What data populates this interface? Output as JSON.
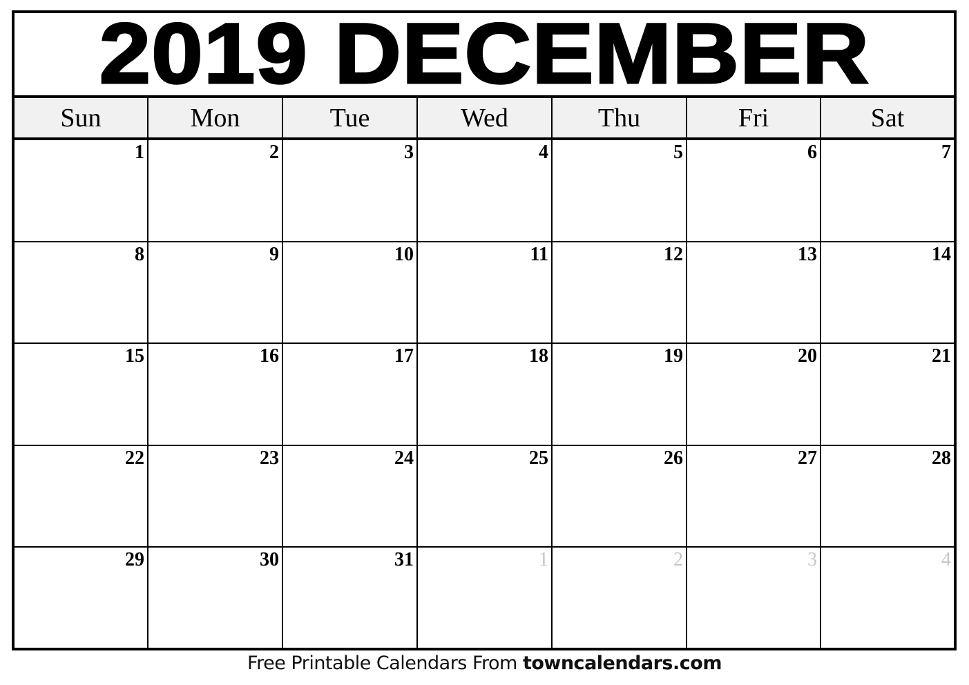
{
  "calendar": {
    "title": "2019 DECEMBER",
    "year": 2019,
    "month": "December",
    "weekdays": [
      "Sun",
      "Mon",
      "Tue",
      "Wed",
      "Thu",
      "Fri",
      "Sat"
    ],
    "weeks": [
      [
        {
          "day": "1"
        },
        {
          "day": "2"
        },
        {
          "day": "3"
        },
        {
          "day": "4"
        },
        {
          "day": "5"
        },
        {
          "day": "6"
        },
        {
          "day": "7"
        }
      ],
      [
        {
          "day": "8"
        },
        {
          "day": "9"
        },
        {
          "day": "10"
        },
        {
          "day": "11"
        },
        {
          "day": "12"
        },
        {
          "day": "13"
        },
        {
          "day": "14"
        }
      ],
      [
        {
          "day": "15"
        },
        {
          "day": "16"
        },
        {
          "day": "17"
        },
        {
          "day": "18"
        },
        {
          "day": "19"
        },
        {
          "day": "20"
        },
        {
          "day": "21"
        }
      ],
      [
        {
          "day": "22"
        },
        {
          "day": "23"
        },
        {
          "day": "24"
        },
        {
          "day": "25"
        },
        {
          "day": "26"
        },
        {
          "day": "27"
        },
        {
          "day": "28"
        }
      ],
      [
        {
          "day": "29"
        },
        {
          "day": "30"
        },
        {
          "day": "31"
        },
        {
          "day": "1",
          "other": true
        },
        {
          "day": "2",
          "other": true
        },
        {
          "day": "3",
          "other": true
        },
        {
          "day": "4",
          "other": true
        }
      ]
    ]
  },
  "colors": {
    "border": "#000000",
    "weekday_bg": "#f1f1f1",
    "other_month_text": "#c6c6c6"
  },
  "footer": {
    "prefix": "Free Printable Calendars From ",
    "site": "towncalendars.com"
  }
}
